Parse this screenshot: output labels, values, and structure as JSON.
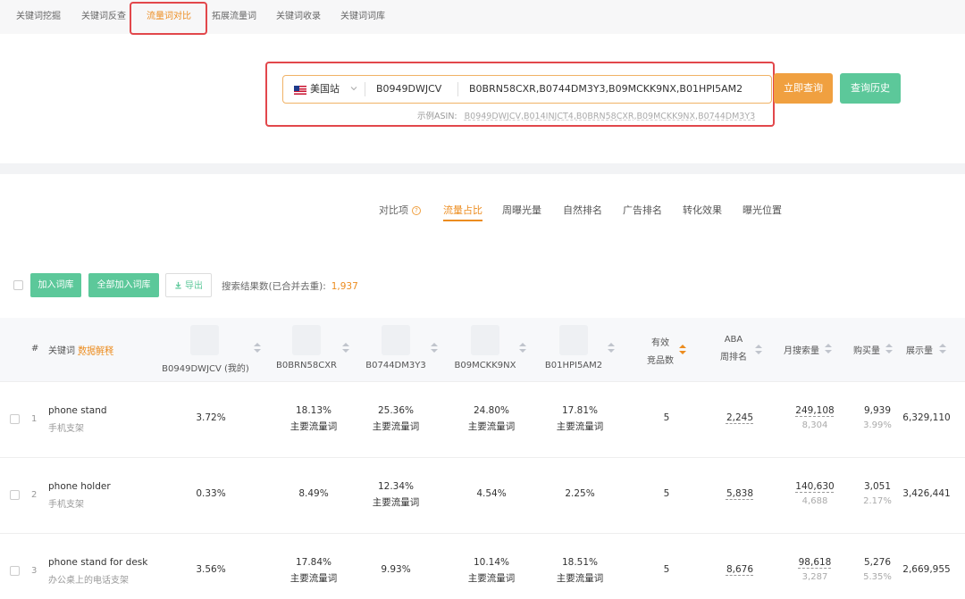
{
  "top_tabs": [
    {
      "label": "关键词挖掘"
    },
    {
      "label": "关键词反查"
    },
    {
      "label": "流量词对比"
    },
    {
      "label": "拓展流量词"
    },
    {
      "label": "关键词收录"
    },
    {
      "label": "关键词词库"
    }
  ],
  "active_tab": "流量词对比",
  "search": {
    "site": "美国站",
    "my_asin": "B0949DWJCV",
    "compare_asins": "B0BRN58CXR,B0744DM3Y3,B09MCKK9NX,B01HPI5AM2",
    "example_label": "示例ASIN:",
    "example_value": "B0949DWJCV,B014INJCT4,B0BRN58CXR,B09MCKK9NX,B0744DM3Y3",
    "query_button": "立即查询",
    "history_button": "查询历史"
  },
  "compare": {
    "label": "对比项",
    "help_icon": "?",
    "tabs": [
      "流量占比",
      "周曝光量",
      "自然排名",
      "广告排名",
      "转化效果",
      "曝光位置"
    ],
    "active": "流量占比"
  },
  "toolbar": {
    "add_button": "加入词库",
    "add_all_button": "全部加入词库",
    "export_button": "导出",
    "result_label": "搜索结果数(已合并去重):",
    "result_count": "1,937"
  },
  "table": {
    "headers": {
      "index": "#",
      "keyword": "关键词",
      "keyword_hint": "数据解释",
      "asins": [
        "B0949DWJCV (我的)",
        "B0BRN58CXR",
        "B0744DM3Y3",
        "B09MCKK9NX",
        "B01HPI5AM2"
      ],
      "competitors_1": "有效",
      "competitors_2": "竞品数",
      "aba_1": "ABA",
      "aba_2": "周排名",
      "monthly_search": "月搜索量",
      "purchases": "购买量",
      "impressions": "展示量"
    },
    "main_tag": "主要流量词",
    "rows": [
      {
        "index": "1",
        "keyword": "phone stand",
        "keyword_cn": "手机支架",
        "shares": [
          {
            "v": "3.72%",
            "main": false
          },
          {
            "v": "18.13%",
            "main": true
          },
          {
            "v": "25.36%",
            "main": true
          },
          {
            "v": "24.80%",
            "main": true
          },
          {
            "v": "17.81%",
            "main": true
          }
        ],
        "competitors": "5",
        "aba": "2,245",
        "monthly": "249,108",
        "monthly_sub": "8,304",
        "purchase": "9,939",
        "purchase_rate": "3.99%",
        "impressions": "6,329,110"
      },
      {
        "index": "2",
        "keyword": "phone holder",
        "keyword_cn": "手机支架",
        "shares": [
          {
            "v": "0.33%",
            "main": false
          },
          {
            "v": "8.49%",
            "main": false
          },
          {
            "v": "12.34%",
            "main": true
          },
          {
            "v": "4.54%",
            "main": false
          },
          {
            "v": "2.25%",
            "main": false
          }
        ],
        "competitors": "5",
        "aba": "5,838",
        "monthly": "140,630",
        "monthly_sub": "4,688",
        "purchase": "3,051",
        "purchase_rate": "2.17%",
        "impressions": "3,426,441"
      },
      {
        "index": "3",
        "keyword": "phone stand for desk",
        "keyword_cn": "办公桌上的电话支架",
        "shares": [
          {
            "v": "3.56%",
            "main": false
          },
          {
            "v": "17.84%",
            "main": true
          },
          {
            "v": "9.93%",
            "main": false
          },
          {
            "v": "10.14%",
            "main": true
          },
          {
            "v": "18.51%",
            "main": true
          }
        ],
        "competitors": "5",
        "aba": "8,676",
        "monthly": "98,618",
        "monthly_sub": "3,287",
        "purchase": "5,276",
        "purchase_rate": "5.35%",
        "impressions": "2,669,955"
      }
    ]
  },
  "colors": {
    "accent": "#ec8c1f",
    "green": "#5cc89a",
    "highlight": "#e2474b"
  }
}
